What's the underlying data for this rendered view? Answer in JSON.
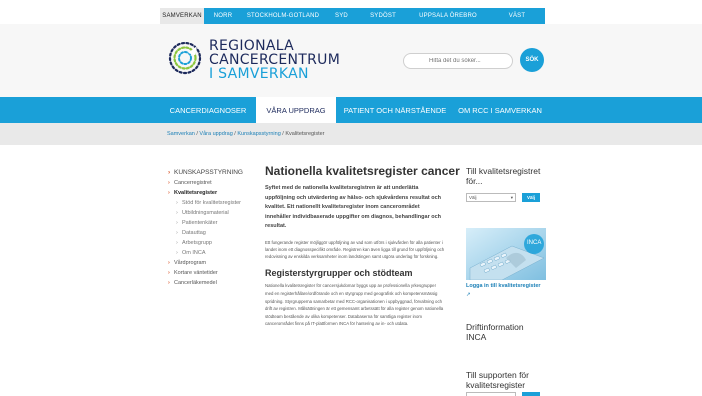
{
  "regions": [
    "SAMVERKAN",
    "NORR",
    "STOCKHOLM-GOTLAND",
    "SYD",
    "SYDÖST",
    "UPPSALA ÖREBRO",
    "VÄST"
  ],
  "logo": {
    "line1": "REGIONALA",
    "line2": "CANCERCENTRUM",
    "line3": "I SAMVERKAN"
  },
  "search": {
    "placeholder": "Hitta det du söker...",
    "button": "SÖK"
  },
  "nav": [
    "CANCERDIAGNOSER",
    "VÅRA UPPDRAG",
    "PATIENT OCH NÄRSTÅENDE",
    "OM RCC I SAMVERKAN"
  ],
  "breadcrumb": {
    "c1": "Samverkan",
    "c2": "Våra uppdrag",
    "c3": "Kunskapsstyrning",
    "c4": "Kvalitetsregister",
    "sep": " / "
  },
  "sidebar": [
    "KUNSKAPSSTYRNING",
    "Cancerregistret",
    "Kvalitetsregister",
    "Stöd för kvalitetsregister",
    "Utbildningsmaterial",
    "Patientenkäter",
    "Datauttag",
    "Arbetsgrupp",
    "Om INCA",
    "Vårdprogram",
    "Kortare väntetider",
    "Cancerläkemedel"
  ],
  "main": {
    "title": "Nationella kvalitetsregister cancer",
    "lead": "Syftet med de nationella kvalitetsregistren är att underlätta uppföljning och utvärdering av hälso- och sjukvårdens resultat och kvalitet. Ett nationellt kvalitetsregister inom cancerområdet innehåller individbaserade uppgifter om diagnos, behandlingar och resultat.",
    "para": "Ett fungerande register möjliggör uppföljning av vad som utförs i sjukvården för alla patienter i landet inom ett diagnosspecifikt område. Registren kan även ligga till grund för uppföljning och redovisning av enskilda verksamheter inom landstingen samt utgöra underlag för forskning.",
    "subhead": "Registerstyrgrupper och stödteam",
    "para2": "Nationella kvalitetsregister för cancersjukdomar byggs upp av professionella yrkesgrupper med en registerhållare/ordförande och en styrgrupp med geografisk och kompetensmässig spridning. Styrgrupperna samarbetar med RCC-organisationen i uppbyggnad, förvaltning och drift av registren. Målsättningen är ett gemensamt arbetssätt för alla register genom nationella stödteam bestående av olika kompetenser. Databaserna för samtliga register inom cancerområdet finns på IT-plattformen INCA för hantering av in- och utdata."
  },
  "right": {
    "title1": "Till kvalitetsregistret för...",
    "select_value": "Välj",
    "go": "Välj",
    "inca_badge": "INCA",
    "inca_link": "Logga in till kvalitetsregister",
    "title2": "Driftinformation INCA",
    "title3": "Till supporten för kvalitetsregister"
  },
  "colors": {
    "brand_blue": "#1aa0d8",
    "navy": "#1d2a5c",
    "accent": "#d9572b"
  }
}
